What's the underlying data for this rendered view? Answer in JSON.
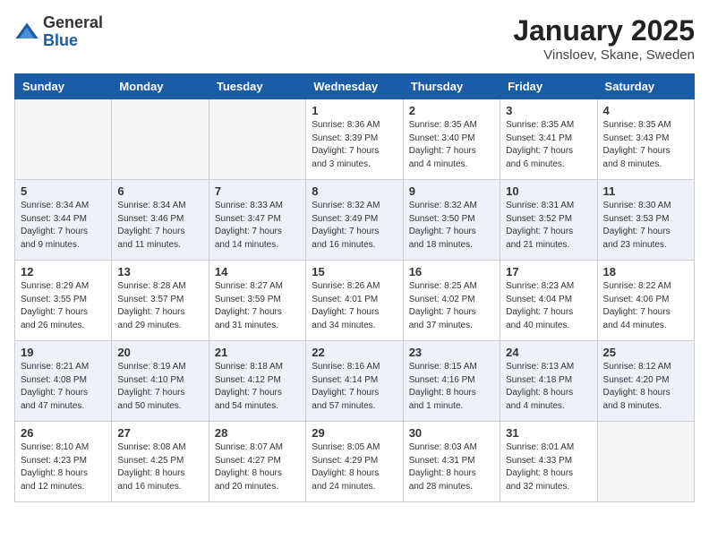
{
  "logo": {
    "general": "General",
    "blue": "Blue"
  },
  "header": {
    "month": "January 2025",
    "location": "Vinsloev, Skane, Sweden"
  },
  "weekdays": [
    "Sunday",
    "Monday",
    "Tuesday",
    "Wednesday",
    "Thursday",
    "Friday",
    "Saturday"
  ],
  "weeks": [
    [
      {
        "day": "",
        "info": ""
      },
      {
        "day": "",
        "info": ""
      },
      {
        "day": "",
        "info": ""
      },
      {
        "day": "1",
        "info": "Sunrise: 8:36 AM\nSunset: 3:39 PM\nDaylight: 7 hours\nand 3 minutes."
      },
      {
        "day": "2",
        "info": "Sunrise: 8:35 AM\nSunset: 3:40 PM\nDaylight: 7 hours\nand 4 minutes."
      },
      {
        "day": "3",
        "info": "Sunrise: 8:35 AM\nSunset: 3:41 PM\nDaylight: 7 hours\nand 6 minutes."
      },
      {
        "day": "4",
        "info": "Sunrise: 8:35 AM\nSunset: 3:43 PM\nDaylight: 7 hours\nand 8 minutes."
      }
    ],
    [
      {
        "day": "5",
        "info": "Sunrise: 8:34 AM\nSunset: 3:44 PM\nDaylight: 7 hours\nand 9 minutes."
      },
      {
        "day": "6",
        "info": "Sunrise: 8:34 AM\nSunset: 3:46 PM\nDaylight: 7 hours\nand 11 minutes."
      },
      {
        "day": "7",
        "info": "Sunrise: 8:33 AM\nSunset: 3:47 PM\nDaylight: 7 hours\nand 14 minutes."
      },
      {
        "day": "8",
        "info": "Sunrise: 8:32 AM\nSunset: 3:49 PM\nDaylight: 7 hours\nand 16 minutes."
      },
      {
        "day": "9",
        "info": "Sunrise: 8:32 AM\nSunset: 3:50 PM\nDaylight: 7 hours\nand 18 minutes."
      },
      {
        "day": "10",
        "info": "Sunrise: 8:31 AM\nSunset: 3:52 PM\nDaylight: 7 hours\nand 21 minutes."
      },
      {
        "day": "11",
        "info": "Sunrise: 8:30 AM\nSunset: 3:53 PM\nDaylight: 7 hours\nand 23 minutes."
      }
    ],
    [
      {
        "day": "12",
        "info": "Sunrise: 8:29 AM\nSunset: 3:55 PM\nDaylight: 7 hours\nand 26 minutes."
      },
      {
        "day": "13",
        "info": "Sunrise: 8:28 AM\nSunset: 3:57 PM\nDaylight: 7 hours\nand 29 minutes."
      },
      {
        "day": "14",
        "info": "Sunrise: 8:27 AM\nSunset: 3:59 PM\nDaylight: 7 hours\nand 31 minutes."
      },
      {
        "day": "15",
        "info": "Sunrise: 8:26 AM\nSunset: 4:01 PM\nDaylight: 7 hours\nand 34 minutes."
      },
      {
        "day": "16",
        "info": "Sunrise: 8:25 AM\nSunset: 4:02 PM\nDaylight: 7 hours\nand 37 minutes."
      },
      {
        "day": "17",
        "info": "Sunrise: 8:23 AM\nSunset: 4:04 PM\nDaylight: 7 hours\nand 40 minutes."
      },
      {
        "day": "18",
        "info": "Sunrise: 8:22 AM\nSunset: 4:06 PM\nDaylight: 7 hours\nand 44 minutes."
      }
    ],
    [
      {
        "day": "19",
        "info": "Sunrise: 8:21 AM\nSunset: 4:08 PM\nDaylight: 7 hours\nand 47 minutes."
      },
      {
        "day": "20",
        "info": "Sunrise: 8:19 AM\nSunset: 4:10 PM\nDaylight: 7 hours\nand 50 minutes."
      },
      {
        "day": "21",
        "info": "Sunrise: 8:18 AM\nSunset: 4:12 PM\nDaylight: 7 hours\nand 54 minutes."
      },
      {
        "day": "22",
        "info": "Sunrise: 8:16 AM\nSunset: 4:14 PM\nDaylight: 7 hours\nand 57 minutes."
      },
      {
        "day": "23",
        "info": "Sunrise: 8:15 AM\nSunset: 4:16 PM\nDaylight: 8 hours\nand 1 minute."
      },
      {
        "day": "24",
        "info": "Sunrise: 8:13 AM\nSunset: 4:18 PM\nDaylight: 8 hours\nand 4 minutes."
      },
      {
        "day": "25",
        "info": "Sunrise: 8:12 AM\nSunset: 4:20 PM\nDaylight: 8 hours\nand 8 minutes."
      }
    ],
    [
      {
        "day": "26",
        "info": "Sunrise: 8:10 AM\nSunset: 4:23 PM\nDaylight: 8 hours\nand 12 minutes."
      },
      {
        "day": "27",
        "info": "Sunrise: 8:08 AM\nSunset: 4:25 PM\nDaylight: 8 hours\nand 16 minutes."
      },
      {
        "day": "28",
        "info": "Sunrise: 8:07 AM\nSunset: 4:27 PM\nDaylight: 8 hours\nand 20 minutes."
      },
      {
        "day": "29",
        "info": "Sunrise: 8:05 AM\nSunset: 4:29 PM\nDaylight: 8 hours\nand 24 minutes."
      },
      {
        "day": "30",
        "info": "Sunrise: 8:03 AM\nSunset: 4:31 PM\nDaylight: 8 hours\nand 28 minutes."
      },
      {
        "day": "31",
        "info": "Sunrise: 8:01 AM\nSunset: 4:33 PM\nDaylight: 8 hours\nand 32 minutes."
      },
      {
        "day": "",
        "info": ""
      }
    ]
  ]
}
